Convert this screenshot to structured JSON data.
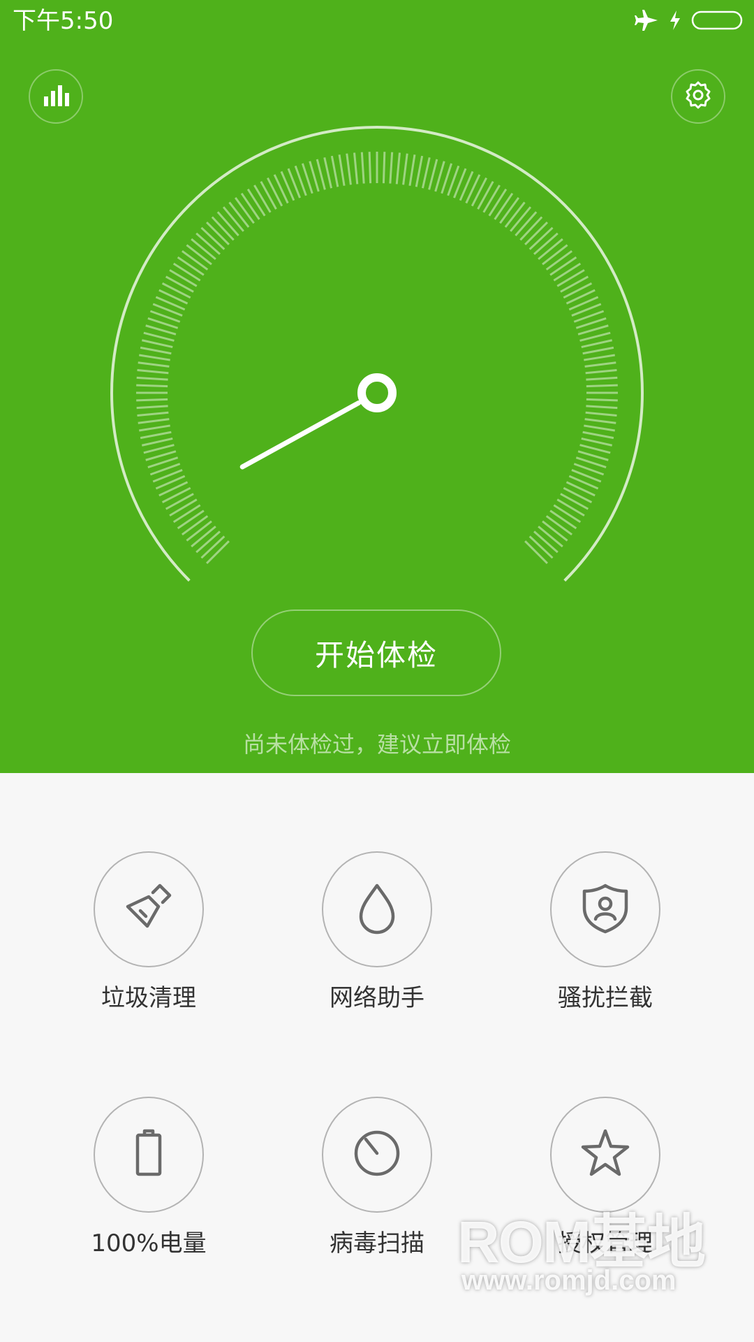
{
  "status_bar": {
    "time": "下午5:50",
    "icons": [
      "airplane-icon",
      "charging-icon",
      "battery-icon"
    ]
  },
  "header": {
    "left_icon": "stats-icon",
    "right_icon": "gear-icon"
  },
  "gauge": {
    "needle_level": 0.06,
    "colors": {
      "background": "#4fb11b",
      "foreground": "#ffffff"
    }
  },
  "main": {
    "start_button": "开始体检",
    "hint": "尚未体检过，建议立即体检"
  },
  "tools": [
    {
      "label": "垃圾清理",
      "icon": "broom-icon"
    },
    {
      "label": "网络助手",
      "icon": "droplet-icon"
    },
    {
      "label": "骚扰拦截",
      "icon": "shield-user-icon"
    },
    {
      "label": "100%电量",
      "icon": "battery-icon"
    },
    {
      "label": "病毒扫描",
      "icon": "scan-dial-icon"
    },
    {
      "label": "授权管理",
      "icon": "star-icon"
    }
  ],
  "watermark": {
    "line1": "ROM基地",
    "line2": "www.romjd.com"
  }
}
